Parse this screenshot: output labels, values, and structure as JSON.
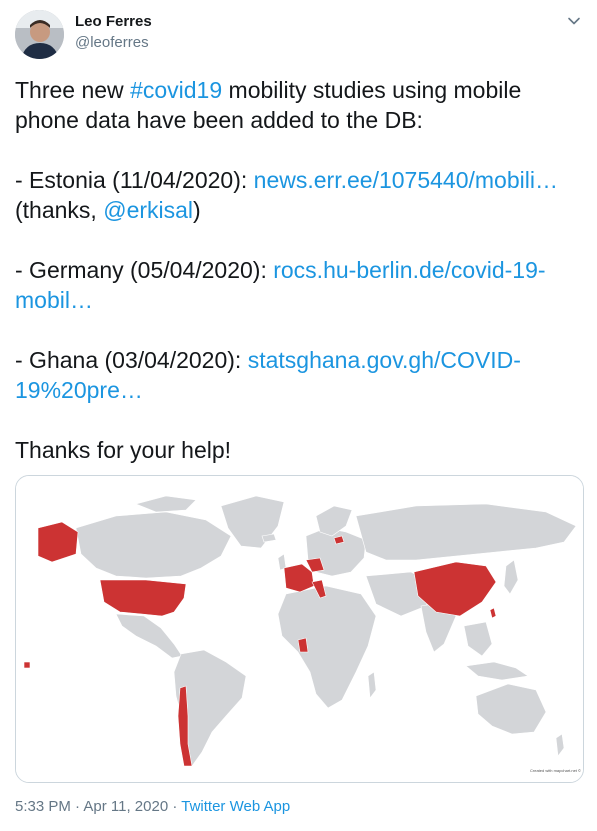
{
  "author": {
    "name": "Leo Ferres",
    "handle": "@leoferres"
  },
  "icons": {
    "more": "chevron-down-icon"
  },
  "tweet": {
    "intro_before": "Three new ",
    "hashtag": "#covid19",
    "intro_after": " mobility studies using mobile phone data have been added to the DB:",
    "estonia_prefix": "- Estonia (11/04/2020): ",
    "estonia_link": "news.err.ee/1075440/mobili…",
    "estonia_thanks_open": "(thanks, ",
    "estonia_mention": "@erkisal",
    "estonia_thanks_close": ")",
    "germany_prefix": "- Germany (05/04/2020): ",
    "germany_link": "rocs.hu-berlin.de/covid-19-mobil…",
    "ghana_prefix": "- Ghana (03/04/2020): ",
    "ghana_link": "statsghana.gov.gh/COVID-19%20pre…",
    "closing": "Thanks for your help!"
  },
  "map": {
    "caption": "Created with mapchart.net ©",
    "highlight_color": "#cc3333",
    "land_color": "#d3d5d8"
  },
  "meta": {
    "time": "5:33 PM",
    "separator": " · ",
    "date": "Apr 11, 2020",
    "source": "Twitter Web App"
  },
  "colors": {
    "link": "#1b95e0",
    "text": "#14171a",
    "secondary": "#657786"
  }
}
